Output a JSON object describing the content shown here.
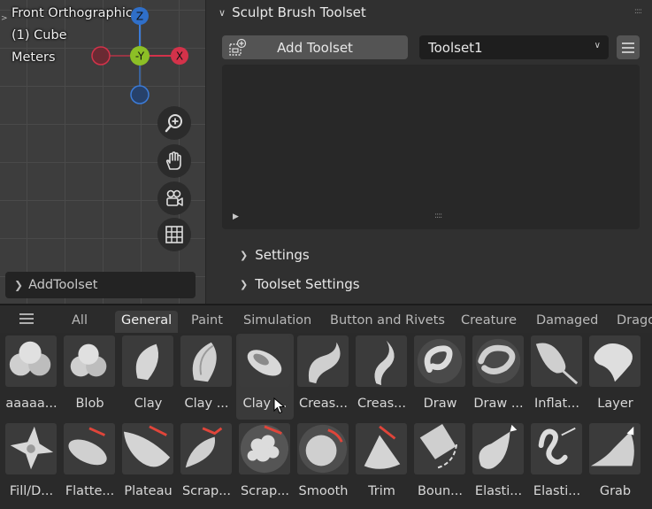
{
  "viewport": {
    "view_name": "Front Orthographic",
    "object_name": "(1) Cube",
    "units": "Meters",
    "collapse_arrow": ">",
    "gizmo": {
      "z_label": "Z",
      "y_label": "-Y",
      "x_label": "X",
      "z_color": "#2f6fc9",
      "y_color": "#8cbf26",
      "x_color": "#d3324a"
    },
    "nav_buttons": [
      "zoom-icon",
      "hand-pan-icon",
      "camera-icon",
      "grid-icon"
    ],
    "addtoolset_label": "AddToolset"
  },
  "panel": {
    "title": "Sculpt Brush Toolset",
    "add_toolset_label": "Add Toolset",
    "toolset_selected": "Toolset1",
    "settings_label": "Settings",
    "toolset_settings_label": "Toolset Settings"
  },
  "browser": {
    "tabs": [
      "All",
      "General",
      "Paint",
      "Simulation",
      "Button and Rivets",
      "Creature",
      "Damaged",
      "Drago"
    ],
    "active_tab": "General",
    "row1": [
      "aaaaa...",
      "Blob",
      "Clay",
      "Clay ...",
      "Clay ...",
      "Creas...",
      "Creas...",
      "Draw",
      "Draw ...",
      "Inflat...",
      "Layer"
    ],
    "row2": [
      "Fill/D...",
      "Flatte...",
      "Plateau",
      "Scrap...",
      "Scrap...",
      "Smooth",
      "Trim",
      "Boun...",
      "Elasti...",
      "Elasti...",
      "Grab"
    ],
    "selected_index": 4
  }
}
